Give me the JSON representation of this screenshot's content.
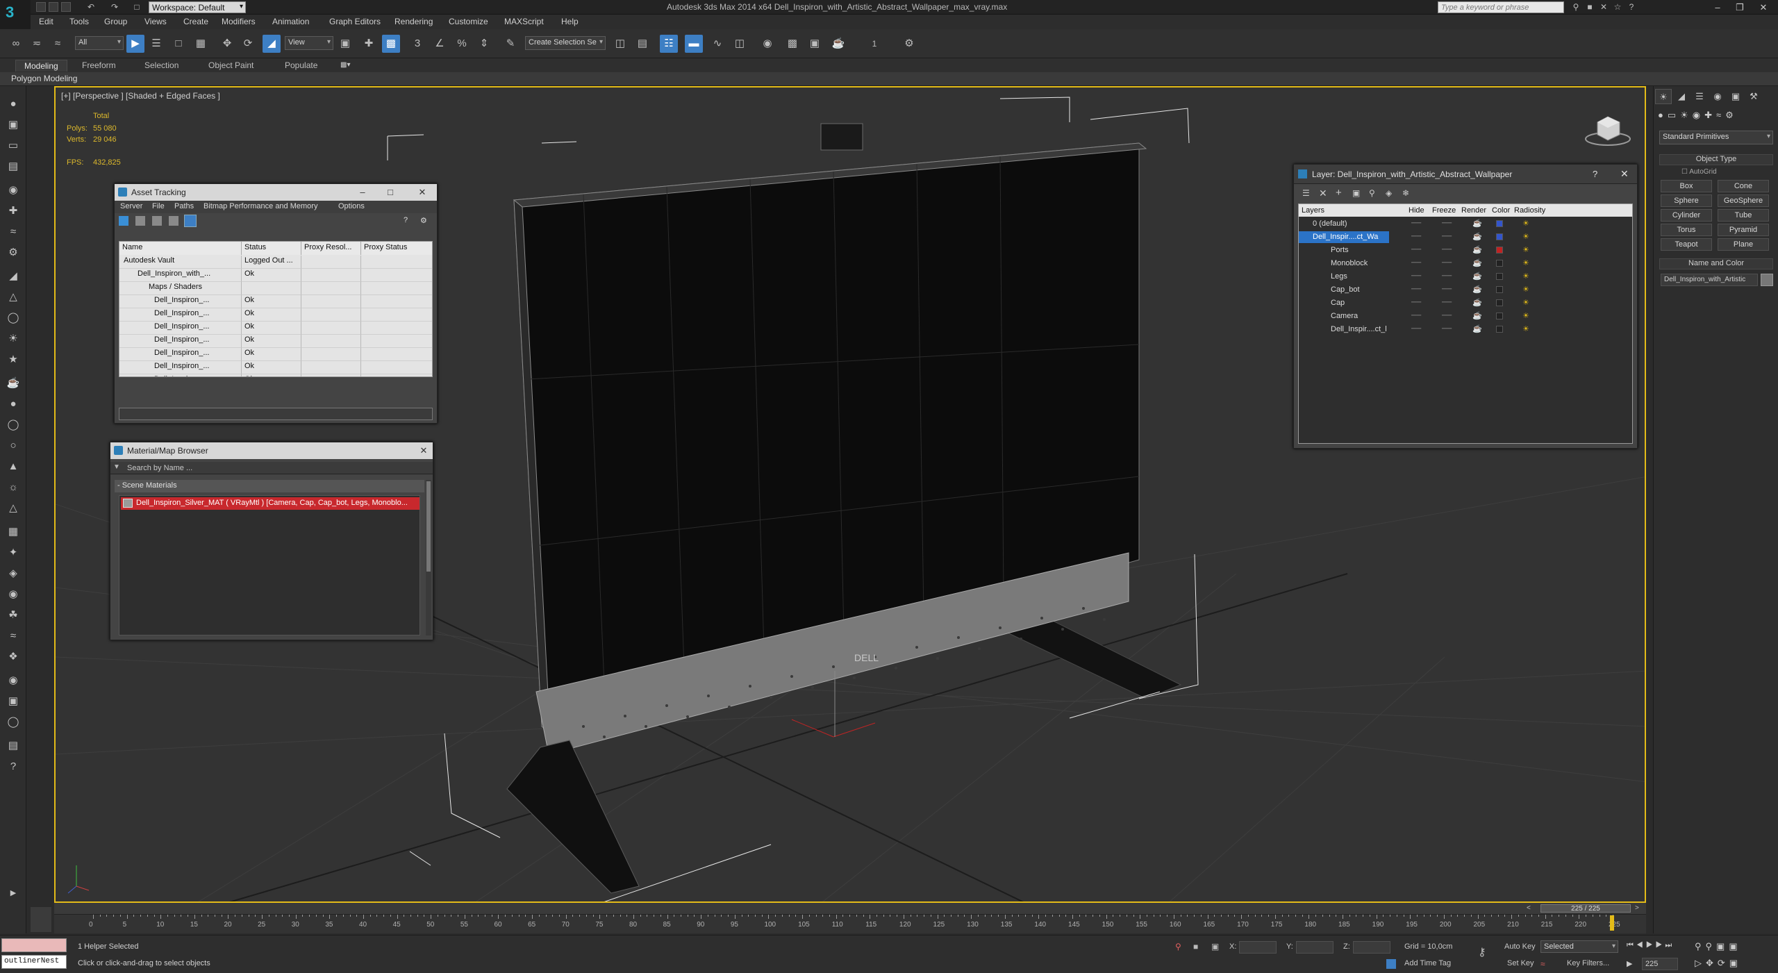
{
  "app": {
    "logo": "3",
    "workspace": "Workspace: Default",
    "title": "Autodesk 3ds Max  2014 x64     Dell_Inspiron_with_Artistic_Abstract_Wallpaper_max_vray.max",
    "search_placeholder": "Type a keyword or phrase"
  },
  "menu": [
    "Edit",
    "Tools",
    "Group",
    "Views",
    "Create",
    "Modifiers",
    "Animation",
    "Graph Editors",
    "Rendering",
    "Customize",
    "MAXScript",
    "Help"
  ],
  "toolbar": {
    "filter": "All",
    "ref_coord": "View",
    "selection_set": "Create Selection Se",
    "counter": "1"
  },
  "ribbon": {
    "tabs": [
      "Modeling",
      "Freeform",
      "Selection",
      "Object Paint",
      "Populate"
    ],
    "active_tab": "Modeling",
    "panel_label": "Polygon Modeling"
  },
  "viewport": {
    "label": "[+] [Perspective ] [Shaded + Edged Faces ]",
    "stats": {
      "total_label": "Total",
      "polys_label": "Polys:",
      "polys_value": "55 080",
      "verts_label": "Verts:",
      "verts_value": "29 046",
      "fps_label": "FPS:",
      "fps_value": "432,825"
    },
    "brand_on_screen": "DELL"
  },
  "asset_tracking": {
    "title": "Asset Tracking",
    "menu": [
      "Server",
      "File",
      "Paths",
      "Bitmap Performance and Memory",
      "Options"
    ],
    "columns": [
      "Name",
      "Status",
      "Proxy Resol...",
      "Proxy Status"
    ],
    "rows": [
      {
        "name": "Autodesk Vault",
        "status": "Logged Out ..."
      },
      {
        "name": "Dell_Inspiron_with_...",
        "status": "Ok"
      },
      {
        "name": "Maps / Shaders",
        "status": ""
      },
      {
        "name": "Dell_Inspiron_...",
        "status": "Ok"
      },
      {
        "name": "Dell_Inspiron_...",
        "status": "Ok"
      },
      {
        "name": "Dell_Inspiron_...",
        "status": "Ok"
      },
      {
        "name": "Dell_Inspiron_...",
        "status": "Ok"
      },
      {
        "name": "Dell_Inspiron_...",
        "status": "Ok"
      },
      {
        "name": "Dell_Inspiron_...",
        "status": "Ok"
      },
      {
        "name": "Dell_Inspiron_...",
        "status": "Ok"
      }
    ]
  },
  "material_browser": {
    "title": "Material/Map Browser",
    "search_placeholder": "Search by Name ...",
    "section": "- Scene Materials",
    "material": "Dell_Inspiron_Silver_MAT ( VRayMtl ) [Camera, Cap, Cap_bot, Legs, Monoblo..."
  },
  "layer_window": {
    "title": "Layer: Dell_Inspiron_with_Artistic_Abstract_Wallpaper",
    "help": "?",
    "columns": [
      "Layers",
      "Hide",
      "Freeze",
      "Render",
      "Color",
      "Radiosity"
    ],
    "rows": [
      {
        "name": "0 (default)",
        "color": "#3355cc",
        "selected": false
      },
      {
        "name": "Dell_Inspir....ct_Wa",
        "color": "#3355cc",
        "selected": true
      },
      {
        "name": "Ports",
        "color": "#c02222",
        "selected": false
      },
      {
        "name": "Monoblock",
        "color": "#222222",
        "selected": false
      },
      {
        "name": "Legs",
        "color": "#222222",
        "selected": false
      },
      {
        "name": "Cap_bot",
        "color": "#222222",
        "selected": false
      },
      {
        "name": "Cap",
        "color": "#222222",
        "selected": false
      },
      {
        "name": "Camera",
        "color": "#222222",
        "selected": false
      },
      {
        "name": "Dell_Inspir....ct_l",
        "color": "#222222",
        "selected": false
      }
    ]
  },
  "command_panel": {
    "dropdown": "Standard Primitives",
    "object_type_title": "Object Type",
    "autogrid": "AutoGrid",
    "buttons": [
      "Box",
      "Cone",
      "Sphere",
      "GeoSphere",
      "Cylinder",
      "Tube",
      "Torus",
      "Pyramid",
      "Teapot",
      "Plane"
    ],
    "name_color_title": "Name and Color",
    "name_value": "Dell_Inspiron_with_Artistic"
  },
  "timeline": {
    "frame_display": "225 / 225",
    "ticks": [
      "0",
      "5",
      "10",
      "15",
      "20",
      "25",
      "30",
      "35",
      "40",
      "45",
      "50",
      "55",
      "60",
      "65",
      "70",
      "75",
      "80",
      "85",
      "90",
      "95",
      "100",
      "105",
      "110",
      "115",
      "120",
      "125",
      "130",
      "135",
      "140",
      "145",
      "150",
      "155",
      "160",
      "165",
      "170",
      "175",
      "180",
      "185",
      "190",
      "195",
      "200",
      "205",
      "210",
      "215",
      "220",
      "225"
    ]
  },
  "status": {
    "script_box": "outlinerNest",
    "selection_info": "1 Helper Selected",
    "prompt": "Click or click-and-drag to select objects",
    "x_label": "X:",
    "y_label": "Y:",
    "z_label": "Z:",
    "grid": "Grid = 10,0cm",
    "add_time_tag": "Add Time Tag",
    "auto_key": "Auto Key",
    "auto_key_mode": "Selected",
    "set_key": "Set Key",
    "key_filters": "Key Filters...",
    "current_frame": "225"
  },
  "colors": {
    "accent_blue": "#3d7fc4",
    "viewport_border": "#e3bb18",
    "stats_yellow": "#dcb82c",
    "material_red": "#c8282d"
  }
}
